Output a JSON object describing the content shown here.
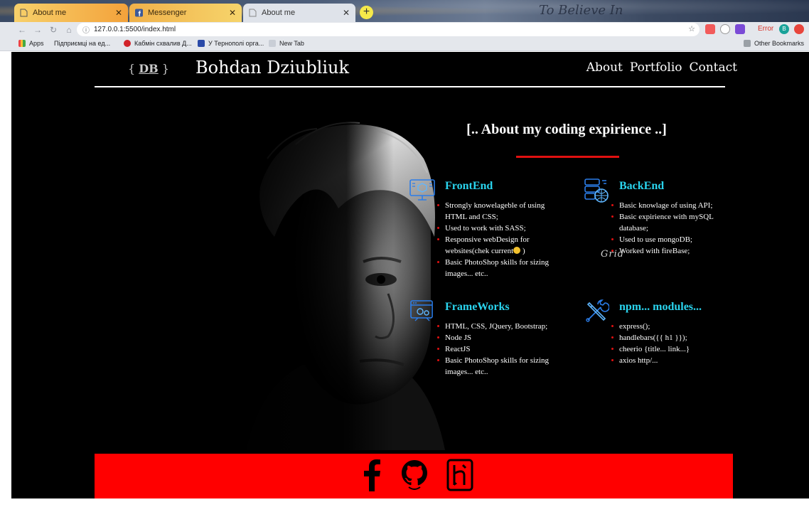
{
  "browser": {
    "tabs": [
      {
        "title": "About me"
      },
      {
        "title": "Messenger"
      },
      {
        "title": "About me"
      }
    ],
    "theme_text": "To Believe In",
    "url": "127.0.0.1:5500/index.html",
    "error_label": "Error",
    "avatar_letter": "B",
    "bookmarks": {
      "apps": "Apps",
      "items": [
        "Підприємці на ед...",
        "Кабмін схвалив Д...",
        "У Тернополі орга...",
        "New Tab"
      ],
      "other": "Other Bookmarks"
    }
  },
  "site": {
    "logo_left": "{",
    "logo_mark": "DB",
    "logo_right": "}",
    "title": "Bohdan Dziubliuk",
    "nav": [
      "About",
      "Portfolio",
      "Contact"
    ],
    "section_title": "[.. About my coding expirience ..]",
    "cards": [
      {
        "title": "FrontEnd",
        "icon": "monitor-cube-icon",
        "items": [
          "Strongly knowelageble of using HTML and CSS;",
          "Used to work with SASS;",
          "Responsive webDesign for websites(chek current",
          "Basic PhotoShop skills for sizing images... etc.."
        ],
        "emoji_suffix": ")"
      },
      {
        "title": "BackEnd",
        "icon": "server-globe-icon",
        "items": [
          "Basic knowlage of using API;",
          "Basic expirience with mySQL database;",
          "Used to use mongoDB;",
          "Worked with fireBase;"
        ]
      },
      {
        "title": "FrameWorks",
        "icon": "browser-gears-icon",
        "items": [
          "HTML, CSS, JQuery, Bootstrap;",
          "Node JS",
          "ReactJS",
          "Basic PhotoShop skills for sizing images... etc.."
        ]
      },
      {
        "title": "npm... modules...",
        "icon": "tools-icon",
        "items": [
          "express();",
          "handlebars({{ h1 }});",
          "cheerio {title... link...}",
          "axios http/..."
        ]
      }
    ],
    "grid_mark": "Grid",
    "social": [
      "facebook-icon",
      "github-icon",
      "heroku-icon"
    ]
  },
  "colors": {
    "accent_cyan": "#2ad4ee",
    "accent_red": "#ff0000",
    "background": "#000000"
  }
}
